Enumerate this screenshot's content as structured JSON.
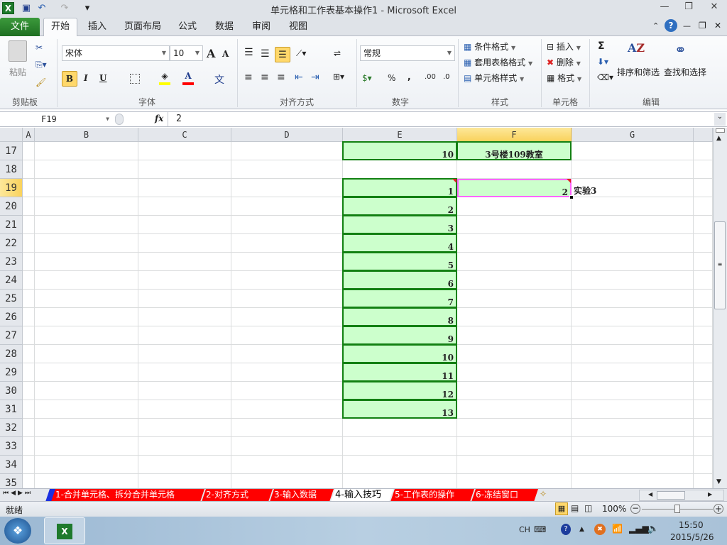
{
  "window": {
    "title": "单元格和工作表基本操作1  -  Microsoft Excel",
    "minimize": "—",
    "restore": "❐",
    "close": "✕"
  },
  "ribbon_tabs": [
    "文件",
    "开始",
    "插入",
    "页面布局",
    "公式",
    "数据",
    "审阅",
    "视图"
  ],
  "clipboard": {
    "paste": "粘贴",
    "label": "剪贴板"
  },
  "font": {
    "name": "宋体",
    "size": "10",
    "bold": "B",
    "italic": "I",
    "underline": "U",
    "grow": "A",
    "shrink": "A",
    "font_color": "A",
    "phonetic": "文",
    "label": "字体"
  },
  "alignment": {
    "label": "对齐方式"
  },
  "number": {
    "format": "常规",
    "percent": "%",
    "comma": ",",
    "inc_decimal": ".00",
    "dec_decimal": ".0",
    "label": "数字"
  },
  "styles": {
    "conditional": "条件格式",
    "table": "套用表格格式",
    "cell_styles": "单元格样式",
    "label": "样式"
  },
  "cells": {
    "insert": "插入",
    "delete": "删除",
    "format": "格式",
    "label": "单元格"
  },
  "editing": {
    "sum": "Σ",
    "sort": "排序和筛选",
    "find": "查找和选择",
    "label": "编辑"
  },
  "formula_bar": {
    "name_box": "F19",
    "fx": "fx",
    "value": "2"
  },
  "columns": [
    "A",
    "B",
    "C",
    "D",
    "E",
    "F",
    "G",
    ""
  ],
  "rows": [
    "17",
    "18",
    "19",
    "20",
    "21",
    "22",
    "23",
    "24",
    "25",
    "26",
    "27",
    "28",
    "29",
    "30",
    "31",
    "32",
    "33",
    "34",
    "35"
  ],
  "cell_values": {
    "E17": "10",
    "F17": "3号楼109教室",
    "E19": "1",
    "F19": "2",
    "G19": "实验3",
    "E20": "2",
    "E21": "3",
    "E22": "4",
    "E23": "5",
    "E24": "6",
    "E25": "7",
    "E26": "8",
    "E27": "9",
    "E28": "10",
    "E29": "11",
    "E30": "12",
    "E31": "13"
  },
  "sheet_tabs": [
    "1-合并单元格、拆分合并单元格",
    "2-对齐方式",
    "3-输入数据",
    "4-输入技巧",
    "5-工作表的操作",
    "6-冻结窗口"
  ],
  "active_sheet": "4-输入技巧",
  "status": {
    "ready": "就绪",
    "zoom": "100%"
  },
  "taskbar": {
    "lang": "CH",
    "time": "15:50",
    "date": "2015/5/26"
  },
  "colors": {
    "fill": "#ccffcc",
    "border": "#128012",
    "tab": "#ff0000",
    "selection": "#ff66ff"
  }
}
